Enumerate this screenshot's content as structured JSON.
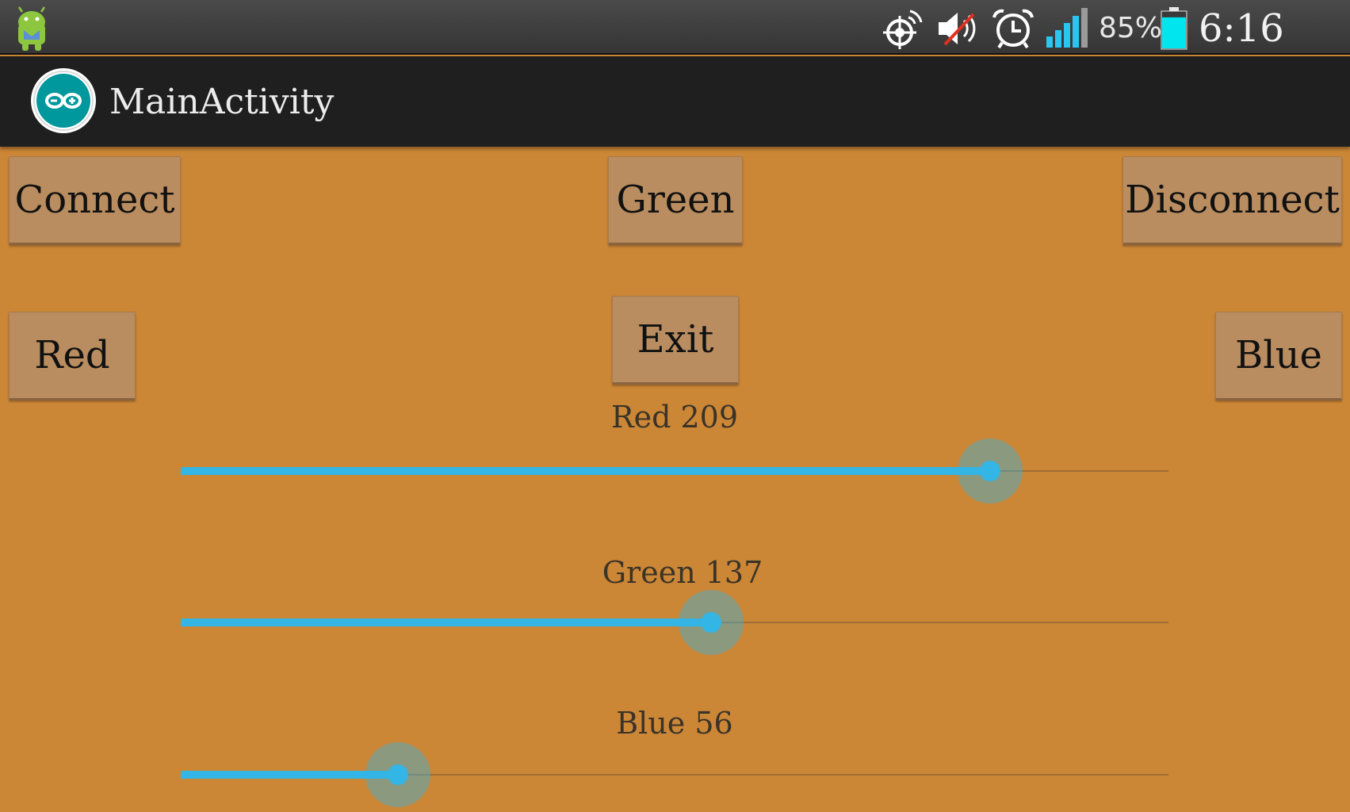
{
  "status_bar": {
    "notification_icon": "android-debug-icon",
    "icons": [
      "gps-icon",
      "mute-icon",
      "alarm-icon",
      "signal-icon"
    ],
    "battery_percent": "85%",
    "battery_level": 0.85,
    "time": "6:16 PM"
  },
  "action_bar": {
    "app_icon": "arduino-logo-icon",
    "title": "MainActivity"
  },
  "buttons": {
    "connect": "Connect",
    "green": "Green",
    "disconnect": "Disconnect",
    "red": "Red",
    "exit": "Exit",
    "blue": "Blue"
  },
  "sliders": {
    "red": {
      "label": "Red 209",
      "value": 209,
      "max": 255
    },
    "green": {
      "label": "Green 137",
      "value": 137,
      "max": 255
    },
    "blue": {
      "label": "Blue 56",
      "value": 56,
      "max": 255
    }
  },
  "colors": {
    "background": "#cb8636",
    "accent": "#33b5e5",
    "battery": "#00e5ee"
  }
}
